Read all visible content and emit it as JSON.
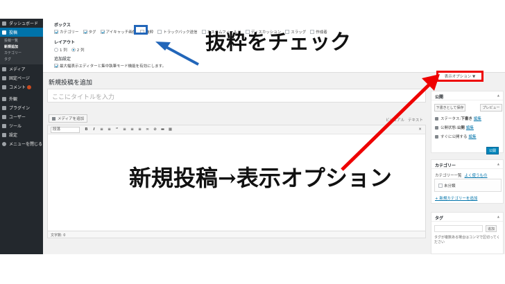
{
  "sidebar": {
    "items": [
      {
        "label": "ダッシュボード"
      },
      {
        "label": "投稿"
      },
      {
        "label": "メディア"
      },
      {
        "label": "固定ページ"
      },
      {
        "label": "コメント"
      },
      {
        "label": "外観"
      },
      {
        "label": "プラグイン"
      },
      {
        "label": "ユーザー"
      },
      {
        "label": "ツール"
      },
      {
        "label": "設定"
      },
      {
        "label": "メニューを閉じる"
      }
    ],
    "sub": [
      "投稿一覧",
      "新規追加",
      "カテゴリー",
      "タグ"
    ]
  },
  "screen_options": {
    "boxes_label": "ボックス",
    "boxes": [
      {
        "label": "カテゴリー",
        "checked": true
      },
      {
        "label": "タグ",
        "checked": true
      },
      {
        "label": "アイキャッチ画像",
        "checked": true
      },
      {
        "label": "抜粋",
        "checked": false
      },
      {
        "label": "トラックバック送信",
        "checked": false
      },
      {
        "label": "カスタムフィールド",
        "checked": false
      },
      {
        "label": "ディスカッション",
        "checked": false
      },
      {
        "label": "スラッグ",
        "checked": false
      },
      {
        "label": "作成者",
        "checked": false
      }
    ],
    "layout_label": "レイアウト",
    "layout_options": [
      "1 列",
      "2 列"
    ],
    "extra_label": "追加設定",
    "extra_option": "最大幅表示エディターと集中執筆モード機能を有効にします。"
  },
  "annotations": {
    "excerpt_note": "抜粋をチェック",
    "display_note": "新規投稿→表示オプション",
    "color_red": "#e00000",
    "color_blue": "#2266b9"
  },
  "editor": {
    "page_title": "新規投稿を追加",
    "title_placeholder": "ここにタイトルを入力",
    "add_media": "メディアを追加",
    "tab_visual": "ビジュアル",
    "tab_text": "テキスト",
    "format_select": "段落",
    "word_count": "文字数: 0"
  },
  "display_options_button": "表示オプション ▼",
  "publish_box": {
    "title": "公開",
    "save_draft": "下書きとして保存",
    "preview": "プレビュー",
    "status_label": "ステータス:",
    "status_value": "下書き",
    "visibility_label": "公開状態:",
    "visibility_value": "公開",
    "schedule_label": "すぐに公開する",
    "edit_link": "編集",
    "publish": "公開"
  },
  "category_box": {
    "title": "カテゴリー",
    "tab_all": "カテゴリー一覧",
    "tab_popular": "よく使うもの",
    "item": "未分類",
    "add_link": "+ 新規カテゴリーを追加"
  },
  "tag_box": {
    "title": "タグ",
    "add": "追加",
    "hint": "タグが複数ある場合はコンマで区切ってください"
  }
}
